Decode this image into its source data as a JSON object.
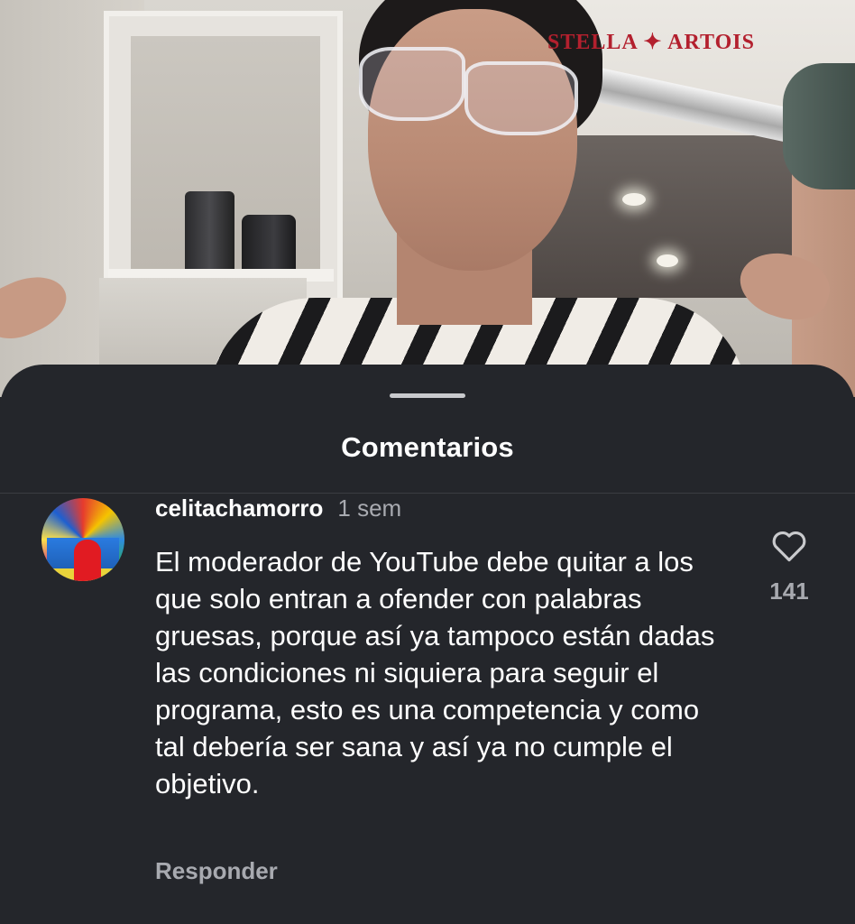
{
  "video": {
    "brand_logo_text": "STELLA ✦ ARTOIS",
    "brand_color": "#b3202e"
  },
  "sheet": {
    "title": "Comentarios"
  },
  "comments": [
    {
      "username": "celitachamorro",
      "time": "1 sem",
      "text": "El moderador de YouTube debe quitar a los que solo entran a ofender con palabras gruesas, porque así ya tampoco están dadas las condiciones ni siquiera para seguir el programa, esto es una competencia y como tal debería ser sana y así ya no cumple el objetivo.",
      "likes": "141",
      "reply_label": "Responder",
      "like_icon": "heart-outline-icon"
    }
  ],
  "colors": {
    "sheet_background": "#24262b",
    "primary_text": "#ffffff",
    "secondary_text": "#a8aab0"
  }
}
